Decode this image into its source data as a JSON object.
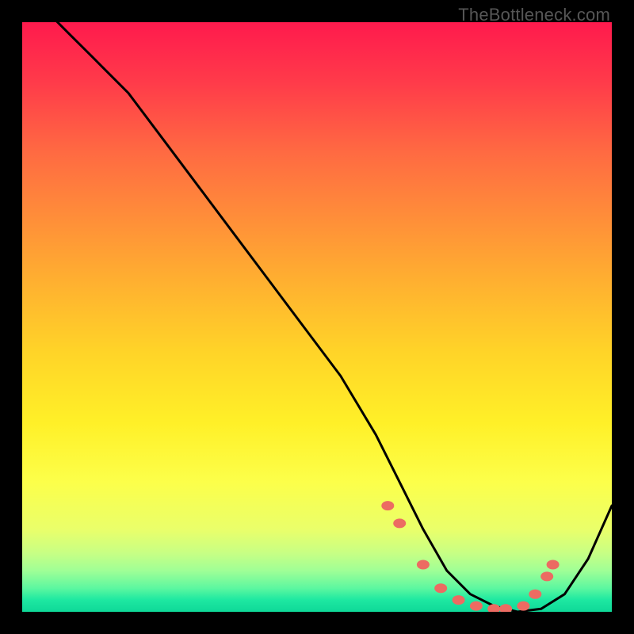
{
  "watermark": "TheBottleneck.com",
  "chart_data": {
    "type": "line",
    "title": "",
    "xlabel": "",
    "ylabel": "",
    "xlim": [
      0,
      100
    ],
    "ylim": [
      0,
      100
    ],
    "grid": false,
    "legend": false,
    "series": [
      {
        "name": "curve",
        "x": [
          0,
          4,
          8,
          12,
          18,
          24,
          30,
          36,
          42,
          48,
          54,
          60,
          64,
          68,
          72,
          76,
          80,
          84,
          88,
          92,
          96,
          100
        ],
        "y": [
          105,
          102,
          98,
          94,
          88,
          80,
          72,
          64,
          56,
          48,
          40,
          30,
          22,
          14,
          7,
          3,
          1,
          0,
          0.5,
          3,
          9,
          18
        ]
      }
    ],
    "markers": {
      "name": "dots",
      "x": [
        62,
        64,
        68,
        71,
        74,
        77,
        80,
        82,
        85,
        87,
        89,
        90
      ],
      "y": [
        18,
        15,
        8,
        4,
        2,
        1,
        0.5,
        0.5,
        1,
        3,
        6,
        8
      ]
    }
  }
}
